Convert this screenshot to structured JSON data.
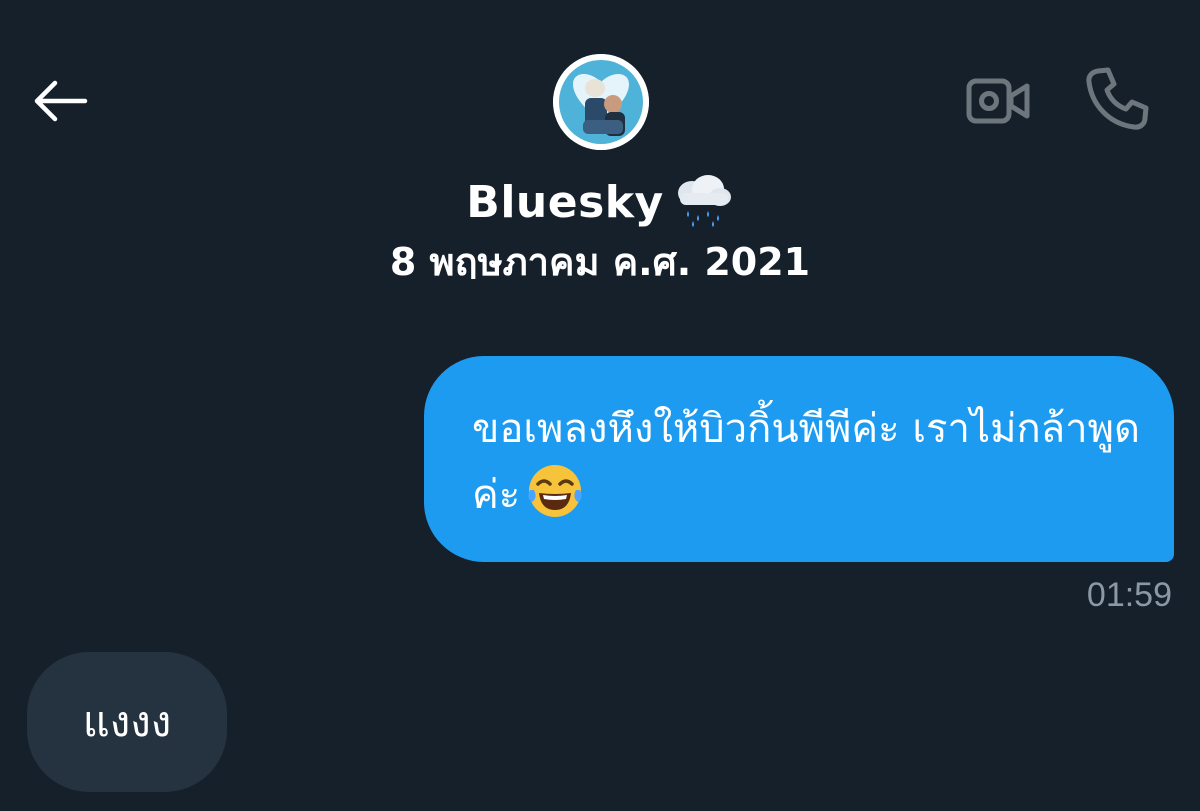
{
  "header": {
    "back_icon": "arrow-left-icon",
    "avatar_icon": "profile-avatar",
    "video_icon": "video-camera-icon",
    "phone_icon": "phone-icon",
    "contact_name": "Bluesky",
    "name_emoji_icon": "cloud-with-rain-icon",
    "date": "8 พฤษภาคม ค.ศ. 2021"
  },
  "messages": {
    "outgoing": {
      "text": "ขอเพลงหึงให้บิวกิ้นพีพีค่ะ เราไม่กล้าพูดค่ะ",
      "emoji_icon": "face-with-tears-of-joy-icon",
      "time": "01:59",
      "bubble_color": "#1d9bf0"
    },
    "incoming": {
      "text": "แงงง",
      "bubble_color": "#253341"
    }
  },
  "colors": {
    "background": "#15202b",
    "timestamp": "#8b98a5",
    "icon_muted": "#6e767d"
  }
}
